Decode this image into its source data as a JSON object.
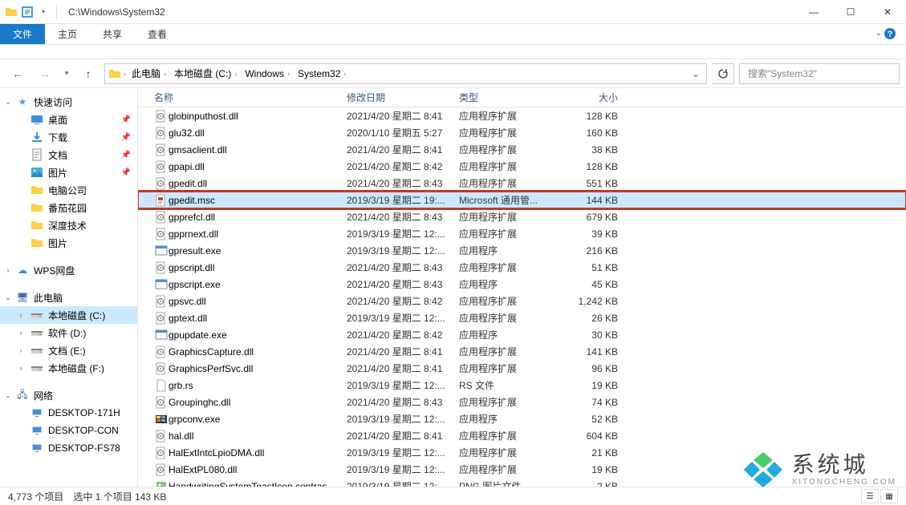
{
  "titlebar": {
    "path": "C:\\Windows\\System32",
    "min": "—",
    "max": "☐",
    "close": "✕"
  },
  "ribbon": {
    "file": "文件",
    "home": "主页",
    "share": "共享",
    "view": "查看"
  },
  "breadcrumb": {
    "segments": [
      "此电脑",
      "本地磁盘 (C:)",
      "Windows",
      "System32"
    ]
  },
  "search": {
    "placeholder": "搜索\"System32\""
  },
  "nav": {
    "quick_access": "快速访问",
    "items_quick": [
      {
        "label": "桌面",
        "icon": "desktop",
        "pinned": true
      },
      {
        "label": "下载",
        "icon": "download",
        "pinned": true
      },
      {
        "label": "文档",
        "icon": "document",
        "pinned": true
      },
      {
        "label": "图片",
        "icon": "picture",
        "pinned": true
      },
      {
        "label": "电脑公司",
        "icon": "folder",
        "pinned": false
      },
      {
        "label": "番茄花园",
        "icon": "folder",
        "pinned": false
      },
      {
        "label": "深度技术",
        "icon": "folder",
        "pinned": false
      },
      {
        "label": "图片",
        "icon": "folder",
        "pinned": false
      }
    ],
    "wps": "WPS网盘",
    "this_pc": "此电脑",
    "drives": [
      {
        "label": "本地磁盘 (C:)",
        "selected": true
      },
      {
        "label": "软件 (D:)",
        "selected": false
      },
      {
        "label": "文档 (E:)",
        "selected": false
      },
      {
        "label": "本地磁盘 (F:)",
        "selected": false
      }
    ],
    "network": "网络",
    "net_items": [
      "DESKTOP-171H",
      "DESKTOP-CON",
      "DESKTOP-FS78"
    ]
  },
  "columns": {
    "name": "名称",
    "date": "修改日期",
    "type": "类型",
    "size": "大小"
  },
  "files": [
    {
      "name": "globinputhost.dll",
      "date": "2021/4/20 星期二 8:41",
      "type": "应用程序扩展",
      "size": "128 KB",
      "icon": "dll"
    },
    {
      "name": "glu32.dll",
      "date": "2020/1/10 星期五 5:27",
      "type": "应用程序扩展",
      "size": "160 KB",
      "icon": "dll"
    },
    {
      "name": "gmsaclient.dll",
      "date": "2021/4/20 星期二 8:41",
      "type": "应用程序扩展",
      "size": "38 KB",
      "icon": "dll"
    },
    {
      "name": "gpapi.dll",
      "date": "2021/4/20 星期二 8:42",
      "type": "应用程序扩展",
      "size": "128 KB",
      "icon": "dll"
    },
    {
      "name": "gpedit.dll",
      "date": "2021/4/20 星期二 8:43",
      "type": "应用程序扩展",
      "size": "551 KB",
      "icon": "dll"
    },
    {
      "name": "gpedit.msc",
      "date": "2019/3/19 星期二 19:...",
      "type": "Microsoft 通用管...",
      "size": "144 KB",
      "icon": "msc",
      "highlighted": true
    },
    {
      "name": "gpprefcl.dll",
      "date": "2021/4/20 星期二 8:43",
      "type": "应用程序扩展",
      "size": "679 KB",
      "icon": "dll"
    },
    {
      "name": "gpprnext.dll",
      "date": "2019/3/19 星期二 12:...",
      "type": "应用程序扩展",
      "size": "39 KB",
      "icon": "dll"
    },
    {
      "name": "gpresult.exe",
      "date": "2019/3/19 星期二 12:...",
      "type": "应用程序",
      "size": "216 KB",
      "icon": "exe"
    },
    {
      "name": "gpscript.dll",
      "date": "2021/4/20 星期二 8:43",
      "type": "应用程序扩展",
      "size": "51 KB",
      "icon": "dll"
    },
    {
      "name": "gpscript.exe",
      "date": "2021/4/20 星期二 8:43",
      "type": "应用程序",
      "size": "45 KB",
      "icon": "exe"
    },
    {
      "name": "gpsvc.dll",
      "date": "2021/4/20 星期二 8:42",
      "type": "应用程序扩展",
      "size": "1,242 KB",
      "icon": "dll"
    },
    {
      "name": "gptext.dll",
      "date": "2019/3/19 星期二 12:...",
      "type": "应用程序扩展",
      "size": "26 KB",
      "icon": "dll"
    },
    {
      "name": "gpupdate.exe",
      "date": "2021/4/20 星期二 8:42",
      "type": "应用程序",
      "size": "30 KB",
      "icon": "exe"
    },
    {
      "name": "GraphicsCapture.dll",
      "date": "2021/4/20 星期二 8:41",
      "type": "应用程序扩展",
      "size": "141 KB",
      "icon": "dll"
    },
    {
      "name": "GraphicsPerfSvc.dll",
      "date": "2021/4/20 星期二 8:41",
      "type": "应用程序扩展",
      "size": "96 KB",
      "icon": "dll"
    },
    {
      "name": "grb.rs",
      "date": "2019/3/19 星期二 12:...",
      "type": "RS 文件",
      "size": "19 KB",
      "icon": "file"
    },
    {
      "name": "Groupinghc.dll",
      "date": "2021/4/20 星期二 8:43",
      "type": "应用程序扩展",
      "size": "74 KB",
      "icon": "dll"
    },
    {
      "name": "grpconv.exe",
      "date": "2019/3/19 星期二 12:...",
      "type": "应用程序",
      "size": "52 KB",
      "icon": "exe2"
    },
    {
      "name": "hal.dll",
      "date": "2021/4/20 星期二 8:41",
      "type": "应用程序扩展",
      "size": "604 KB",
      "icon": "dll"
    },
    {
      "name": "HalExtIntcLpioDMA.dll",
      "date": "2019/3/19 星期二 12:...",
      "type": "应用程序扩展",
      "size": "21 KB",
      "icon": "dll"
    },
    {
      "name": "HalExtPL080.dll",
      "date": "2019/3/19 星期二 12:...",
      "type": "应用程序扩展",
      "size": "19 KB",
      "icon": "dll"
    },
    {
      "name": "HandwritingSystemToastIcon.contras",
      "date": "2019/3/19 星期二 12:",
      "type": "PNG 图片文件",
      "size": "2 KB",
      "icon": "png"
    }
  ],
  "status": {
    "count": "4,773 个项目",
    "selection": "选中 1 个项目 143 KB"
  },
  "watermark": {
    "big": "系统城",
    "small": "XITONGCHENG.COM"
  }
}
